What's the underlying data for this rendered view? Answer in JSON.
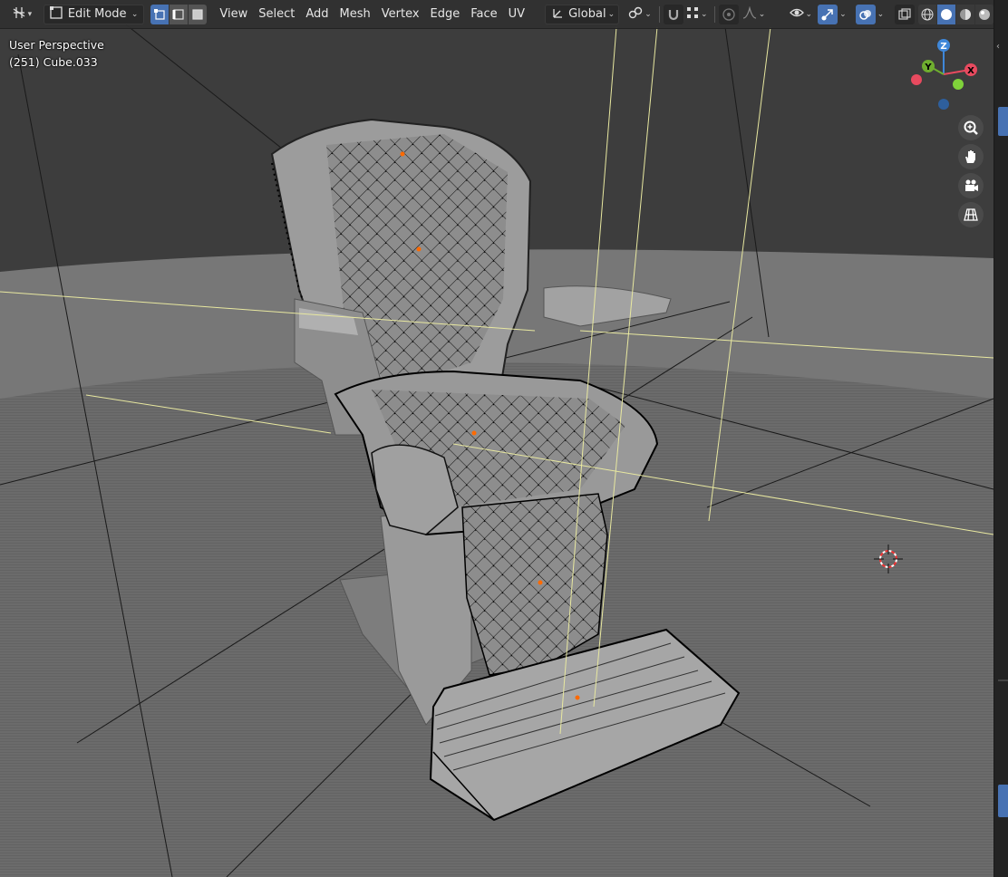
{
  "header": {
    "editor_type_icon": "viewport-icon",
    "mode_label": "Edit Mode",
    "select_modes": [
      {
        "name": "vertex-select-mode",
        "active": true
      },
      {
        "name": "edge-select-mode",
        "active": false
      },
      {
        "name": "face-select-mode",
        "active": false
      }
    ],
    "menus": [
      "View",
      "Select",
      "Add",
      "Mesh",
      "Vertex",
      "Edge",
      "Face",
      "UV"
    ],
    "transform_orientation": "Global",
    "pivot_icon": "link-icon",
    "snap_icon": "magnet-icon",
    "snap_target_icon": "snap-grid-icon",
    "proportional_icon": "proportional-edit-icon",
    "falloff_icon": "falloff-curve-icon",
    "visibility_icon": "eye-icon",
    "gizmo_icon": "gizmo-icon",
    "overlay_icon": "overlay-icon",
    "xray_icon": "xray-icon",
    "shading_modes": [
      "wireframe",
      "solid",
      "material-preview",
      "rendered"
    ]
  },
  "viewport": {
    "perspective_label": "User Perspective",
    "object_label": "(251) Cube.033"
  },
  "nav_gizmo": {
    "axes": [
      "X",
      "Y",
      "Z"
    ],
    "colors": {
      "x": "#e84a5f",
      "y": "#6fae2f",
      "z": "#3f87d9"
    }
  },
  "nav_buttons": [
    "zoom-icon",
    "pan-hand-icon",
    "camera-icon",
    "ortho-grid-icon"
  ],
  "colors": {
    "header_bg": "#303030",
    "active_blue": "#4772b3",
    "floor": "#6e6e6e",
    "background": "#3d3d3d",
    "mesh": "#9a9a9a"
  }
}
